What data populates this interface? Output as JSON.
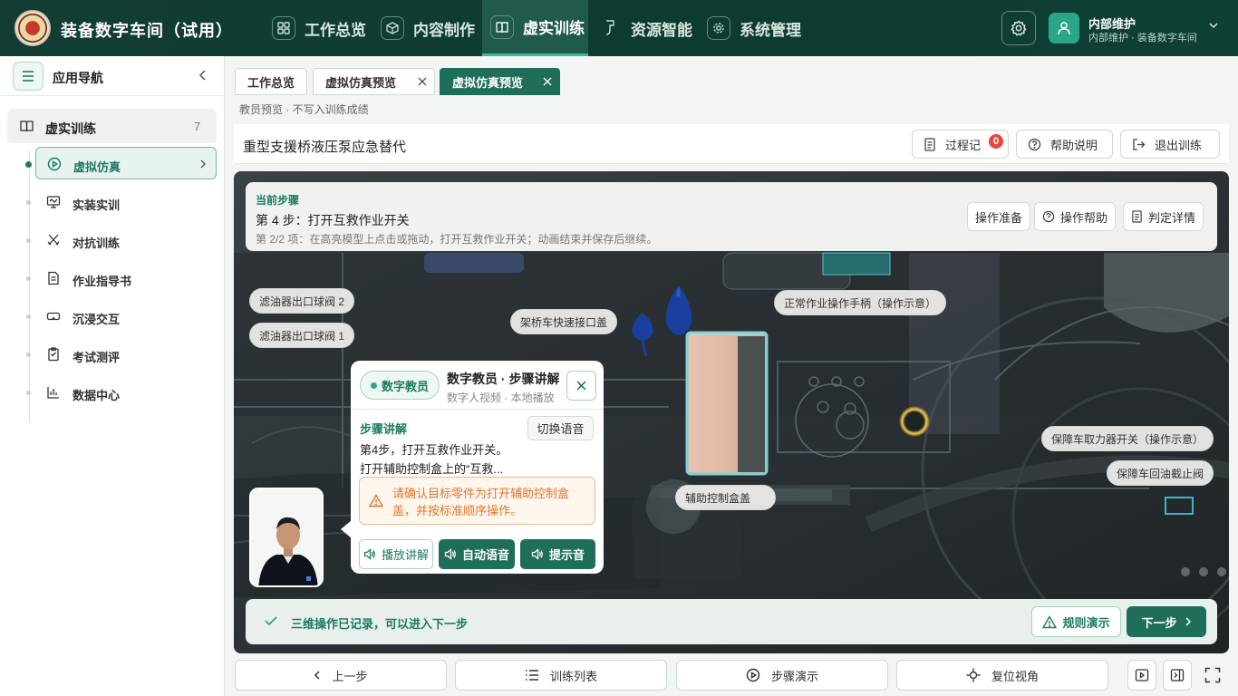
{
  "app": {
    "title": "装备数字车间（试用）"
  },
  "nav": [
    {
      "label": "工作总览",
      "icon": "grid-icon"
    },
    {
      "label": "内容制作",
      "icon": "cube-icon"
    },
    {
      "label": "虚实训练",
      "icon": "book-icon",
      "active": true
    },
    {
      "label": "资源智能",
      "icon": "plug-icon"
    },
    {
      "label": "系统管理",
      "icon": "gear-icon"
    }
  ],
  "user": {
    "name": "内部维护",
    "sub": "内部维护 · 装备数字车间"
  },
  "sidebar": {
    "title": "应用导航",
    "group": {
      "label": "虚实训练",
      "count": "7"
    },
    "items": [
      {
        "label": "虚拟仿真",
        "icon": "play-circle-icon",
        "active": true
      },
      {
        "label": "实装实训",
        "icon": "monitor-icon"
      },
      {
        "label": "对抗训练",
        "icon": "swords-icon"
      },
      {
        "label": "作业指导书",
        "icon": "document-icon"
      },
      {
        "label": "沉浸交互",
        "icon": "vr-goggles-icon"
      },
      {
        "label": "考试测评",
        "icon": "exam-icon"
      },
      {
        "label": "数据中心",
        "icon": "chart-icon"
      }
    ]
  },
  "tabs": [
    {
      "label": "工作总览"
    },
    {
      "label": "虚拟仿真预览"
    },
    {
      "label": "虚拟仿真预览",
      "active": true
    }
  ],
  "page": {
    "subtitle": "教员预览 · 不写入训练成绩",
    "title": "重型支援桥液压泵应急替代",
    "buttons": {
      "record": "过程记",
      "record_badge": "0",
      "help": "帮助说明",
      "exit": "退出训练"
    }
  },
  "step": {
    "heading": "当前步骤",
    "name": "第 4 步：打开互救作业开关",
    "desc": "第 2/2 项：在高亮模型上点击或拖动，打开互救作业开关；动画结束并保存后继续。",
    "buttons": {
      "prepare": "操作准备",
      "help": "操作帮助",
      "detail": "判定详情"
    }
  },
  "scene_tags": {
    "filter2": "滤油器出口球阀 2",
    "filter1": "滤油器出口球阀 1",
    "bridge_cap": "架桥车快速接口盖",
    "handle": "正常作业操作手柄（操作示意）",
    "pto": "保障车取力器开关（操作示意）",
    "return_valve": "保障车回油截止阀",
    "aux_box": "辅助控制盒盖"
  },
  "tutor": {
    "badge": "数字教员",
    "name": "数字教员 · 步骤讲解",
    "meta": "数字人视频 · 本地播放",
    "expl_head": "步骤讲解",
    "switch_voice": "切换语音",
    "line1": "第4步，打开互救作业开关。",
    "line2": "打开辅助控制盒上的“互救...",
    "warning": "请确认目标零件为打开辅助控制盒盖，并按标准顺序操作。",
    "buttons": {
      "play": "播放讲解",
      "auto": "自动语音",
      "tone": "提示音"
    }
  },
  "status": {
    "text": "三维操作已记录，可以进入下一步",
    "rule": "规则演示",
    "next": "下一步"
  },
  "bottom": {
    "prev": "上一步",
    "list": "训练列表",
    "demo": "步骤演示",
    "reset": "复位视角"
  },
  "colors": {
    "primary": "#1f6e5a",
    "accent": "#2aa585",
    "header": "#133d34",
    "warning": "#e2752a",
    "badge": "#e5483b"
  }
}
